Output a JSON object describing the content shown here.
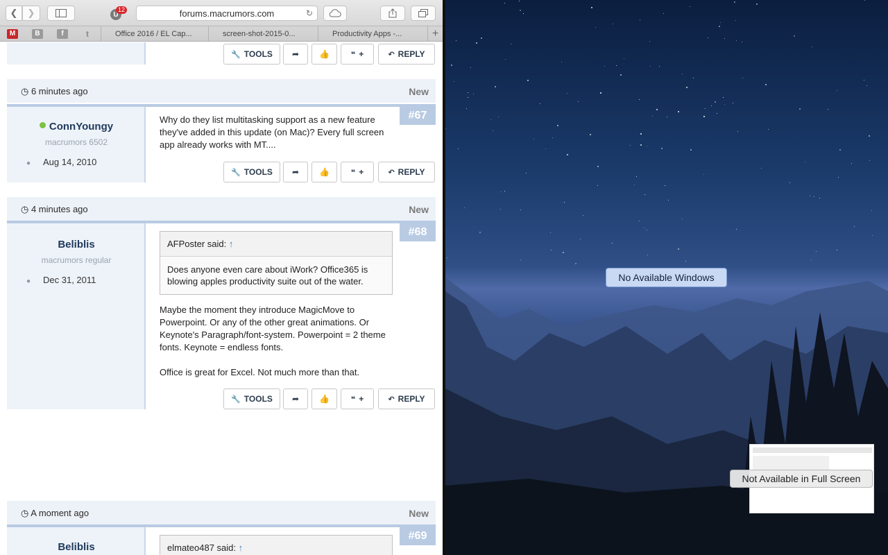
{
  "browser": {
    "url": "forums.macrumors.com",
    "ublock_count": "12",
    "favorites": [
      {
        "icon": "macrumors-fav-icon",
        "letter": "M",
        "color": "#c7282c"
      },
      {
        "icon": "b-fav-icon",
        "letter": "B",
        "color": "#9a9a9a"
      },
      {
        "icon": "facebook-fav-icon",
        "letter": "f",
        "color": "#9a9a9a"
      },
      {
        "icon": "twitter-fav-icon",
        "letter": "t",
        "color": "#9a9a9a"
      }
    ],
    "tabs": [
      "Office 2016 / EL Cap...",
      "screen-shot-2015-0...",
      "Productivity Apps -..."
    ]
  },
  "actions": {
    "tools": "TOOLS",
    "like_plus": "+",
    "reply": "REPLY"
  },
  "posts": [
    {
      "time": "6 minutes ago",
      "new_label": "New",
      "number": "#67",
      "username": "ConnYoungy",
      "online": true,
      "user_title": "macrumors 6502",
      "join_date": "Aug 14, 2010",
      "message": "Why do they list multitasking support as a new feature they've added in this update (on Mac)? Every full screen app already works with MT...."
    },
    {
      "time": "4 minutes ago",
      "new_label": "New",
      "number": "#68",
      "username": "Beliblis",
      "online": false,
      "user_title": "macrumors regular",
      "join_date": "Dec 31, 2011",
      "quote_author": "AFPoster said:",
      "quote_text": "Does anyone even care about iWork? Office365 is blowing apples productivity suite out of the water.",
      "message_p1": "Maybe the moment they introduce MagicMove to Powerpoint. Or any of the other great animations. Or Keynote's Paragraph/font-system. Powerpoint = 2 theme fonts. Keynote = endless fonts.",
      "message_p2": "Office is great for Excel. Not much more than that."
    },
    {
      "time": "A moment ago",
      "new_label": "New",
      "number": "#69",
      "username": "Beliblis",
      "quote_author": "elmateo487 said:"
    }
  ],
  "desktop": {
    "no_windows": "No Available Windows",
    "not_available": "Not Available in Full Screen"
  }
}
